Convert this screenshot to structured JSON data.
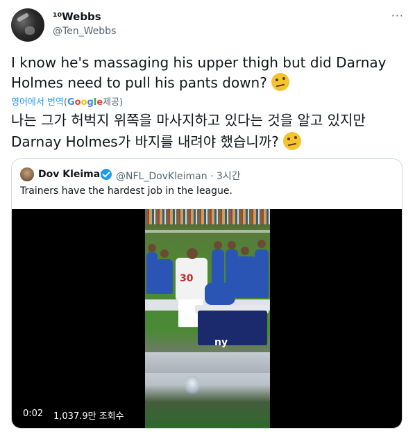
{
  "author": {
    "display_name": "¹⁰Webbs",
    "handle": "@Ten_Webbs"
  },
  "tweet": {
    "text": "I know he's massaging his upper thigh but did Darnay Holmes need to pull his pants down?",
    "emoji": "thinking-face-raised-eyebrow"
  },
  "translation": {
    "link_label": "영어에서 번역",
    "open_paren": "(",
    "google_letters": [
      "G",
      "o",
      "o",
      "g",
      "l",
      "e"
    ],
    "provided_label": "제공)",
    "text": "나는 그가 허벅지 위쪽을 마사지하고 있다는 것을 알고 있지만 Darnay Holmes가 바지를 내려야 했습니까?"
  },
  "quote": {
    "display_name": "Dov Kleiman",
    "handle": "@NFL_DovKleiman",
    "separator": "·",
    "time": "3시간",
    "text": "Trainers have the hardest job in the league.",
    "video": {
      "time": "0:02",
      "views": "1,037.9만 조회수",
      "player_number": "30",
      "cooler_logo": "ny"
    }
  },
  "colors": {
    "text": "#0f1419",
    "muted": "#536471",
    "link": "#1d9bf0",
    "border": "#cfd9de"
  },
  "icons": {
    "more": "more-horizontal-icon",
    "verified": "verified-badge-icon"
  }
}
